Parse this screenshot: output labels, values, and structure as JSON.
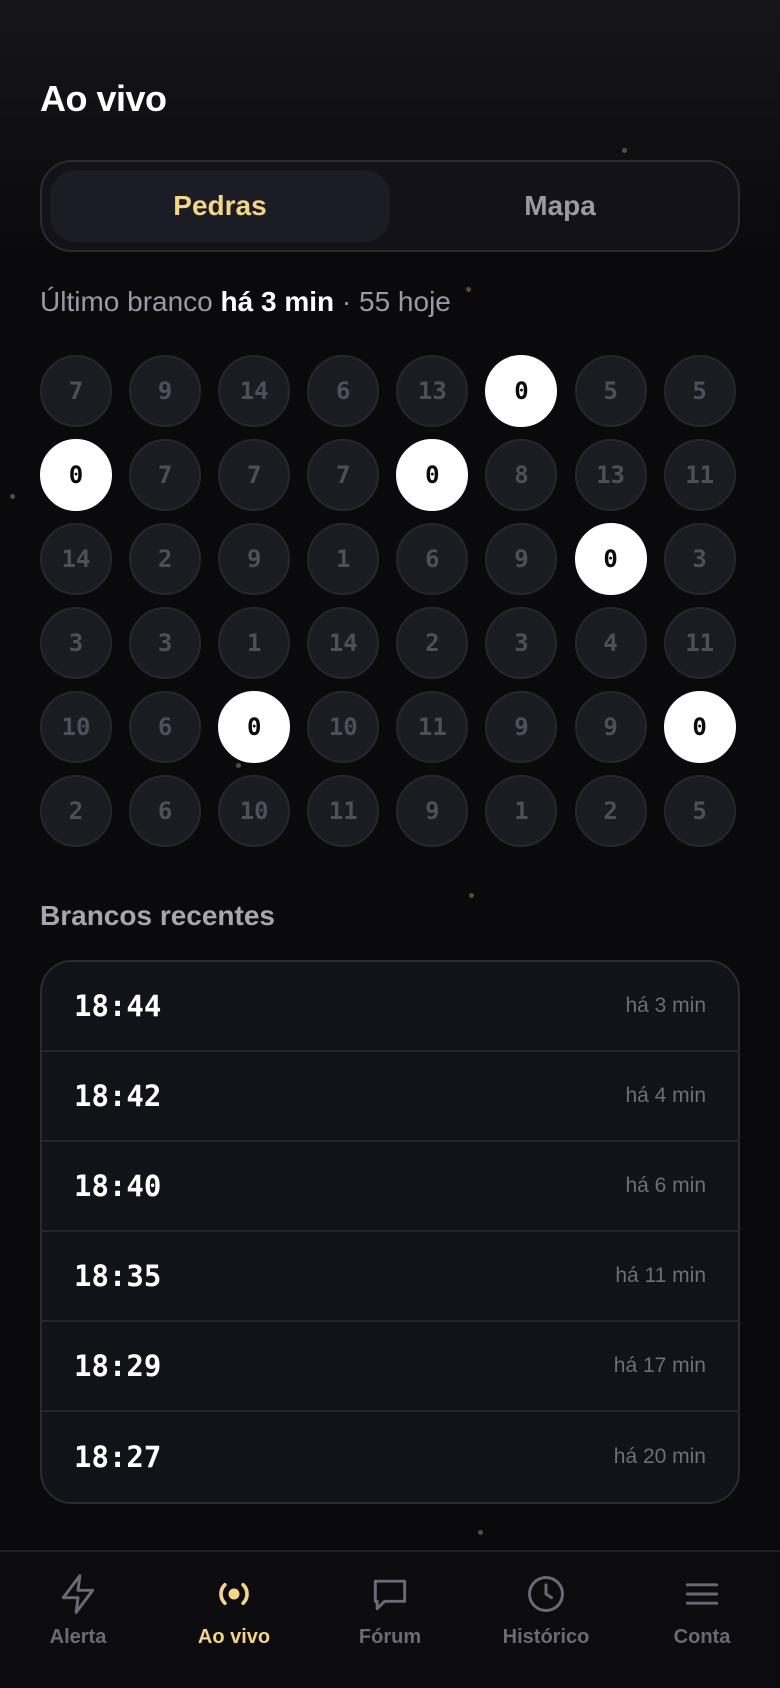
{
  "header": {
    "title": "Ao vivo"
  },
  "segmented": {
    "stones_label": "Pedras",
    "map_label": "Mapa",
    "active": "stones"
  },
  "status": {
    "prefix": "Último branco",
    "highlight": "há 3 min",
    "suffix": "· 55 hoje"
  },
  "stones": [
    "7",
    "9",
    "14",
    "6",
    "13",
    "0",
    "5",
    "5",
    "0",
    "7",
    "7",
    "7",
    "0",
    "8",
    "13",
    "11",
    "14",
    "2",
    "9",
    "1",
    "6",
    "9",
    "0",
    "3",
    "3",
    "3",
    "1",
    "14",
    "2",
    "3",
    "4",
    "11",
    "10",
    "6",
    "0",
    "10",
    "11",
    "9",
    "9",
    "0",
    "2",
    "6",
    "10",
    "11",
    "9",
    "1",
    "2",
    "5"
  ],
  "recent": {
    "title": "Brancos recentes",
    "items": [
      {
        "time": "18:44",
        "ago": "há 3 min"
      },
      {
        "time": "18:42",
        "ago": "há 4 min"
      },
      {
        "time": "18:40",
        "ago": "há 6 min"
      },
      {
        "time": "18:35",
        "ago": "há 11 min"
      },
      {
        "time": "18:29",
        "ago": "há 17 min"
      },
      {
        "time": "18:27",
        "ago": "há 20 min"
      }
    ]
  },
  "tabbar": {
    "items": [
      {
        "label": "Alerta",
        "icon": "lightning-icon"
      },
      {
        "label": "Ao vivo",
        "icon": "live-broadcast-icon"
      },
      {
        "label": "Fórum",
        "icon": "chat-bubble-icon"
      },
      {
        "label": "Histórico",
        "icon": "clock-icon"
      },
      {
        "label": "Conta",
        "icon": "menu-icon"
      }
    ]
  },
  "colors": {
    "accent": "#f3d58a",
    "background": "#0a0a0c",
    "stone": "#1b1b22",
    "white_stone": "#ffffff"
  }
}
